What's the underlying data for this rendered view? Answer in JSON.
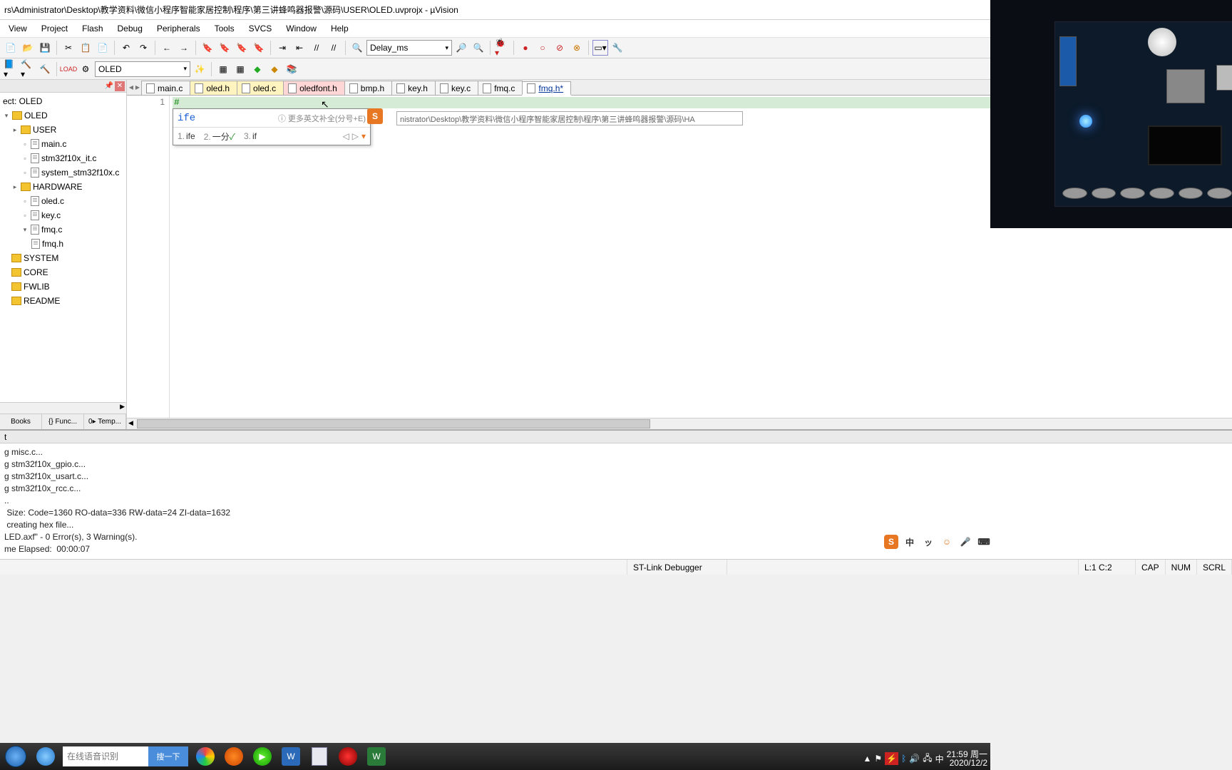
{
  "title": "rs\\Administrator\\Desktop\\教学资料\\微信小程序智能家居控制\\程序\\第三讲蜂鸣器报警\\源码\\USER\\OLED.uvprojx - µVision",
  "menu": [
    "View",
    "Project",
    "Flash",
    "Debug",
    "Peripherals",
    "Tools",
    "SVCS",
    "Window",
    "Help"
  ],
  "toolbar_combo": "Delay_ms",
  "target_combo": "OLED",
  "project_tree": {
    "root_label": "ect: OLED",
    "target": "OLED",
    "groups": [
      {
        "name": "USER",
        "expanded": true,
        "files": [
          "main.c",
          "stm32f10x_it.c",
          "system_stm32f10x.c"
        ]
      },
      {
        "name": "HARDWARE",
        "expanded": true,
        "files": [
          "oled.c",
          "key.c",
          "fmq.c"
        ],
        "sub": [
          {
            "parent": "fmq.c",
            "file": "fmq.h"
          }
        ]
      },
      {
        "name": "SYSTEM",
        "expanded": false
      },
      {
        "name": "CORE",
        "expanded": false
      },
      {
        "name": "FWLIB",
        "expanded": false
      },
      {
        "name": "README",
        "expanded": false
      }
    ]
  },
  "sidebar_tabs": [
    "Books",
    "{} Func...",
    "0▸ Temp..."
  ],
  "editor_tabs": [
    {
      "label": "main.c",
      "style": ""
    },
    {
      "label": "oled.h",
      "style": "special-yellow"
    },
    {
      "label": "oled.c",
      "style": "special-yellow"
    },
    {
      "label": "oledfont.h",
      "style": "special-pink"
    },
    {
      "label": "bmp.h",
      "style": ""
    },
    {
      "label": "key.h",
      "style": ""
    },
    {
      "label": "key.c",
      "style": ""
    },
    {
      "label": "fmq.c",
      "style": ""
    },
    {
      "label": "fmq.h*",
      "style": "active"
    }
  ],
  "editor": {
    "line_no": "1",
    "line_text": "#"
  },
  "ime": {
    "input": "ife",
    "hint": "ⓘ 更多英文补全(分号+E)",
    "candidates": [
      "ife",
      "一分",
      "if"
    ],
    "cand_nums": [
      "1.",
      "2.",
      "3."
    ]
  },
  "path_hint": "nistrator\\Desktop\\教学资料\\微信小程序智能家居控制\\程序\\第三讲蜂鸣器报警\\源码\\HA",
  "build_output": {
    "title": "t",
    "lines": [
      "g misc.c...",
      "g stm32f10x_gpio.c...",
      "g stm32f10x_usart.c...",
      "g stm32f10x_rcc.c...",
      "..",
      " Size: Code=1360 RO-data=336 RW-data=24 ZI-data=1632",
      " creating hex file...",
      "LED.axf\" - 0 Error(s), 3 Warning(s).",
      "me Elapsed:  00:00:07"
    ]
  },
  "status": {
    "debugger": "ST-Link Debugger",
    "pos": "L:1 C:2",
    "caps": "CAP",
    "num": "NUM",
    "scrl": "SCRL"
  },
  "search_placeholder": "在线语音识别",
  "search_btn": "搜一下",
  "clock": {
    "time": "21:59 周一",
    "date": "2020/12/2"
  },
  "ime_tray": [
    "S",
    "中",
    "ッ",
    "☺",
    "🎤",
    "⌨"
  ]
}
